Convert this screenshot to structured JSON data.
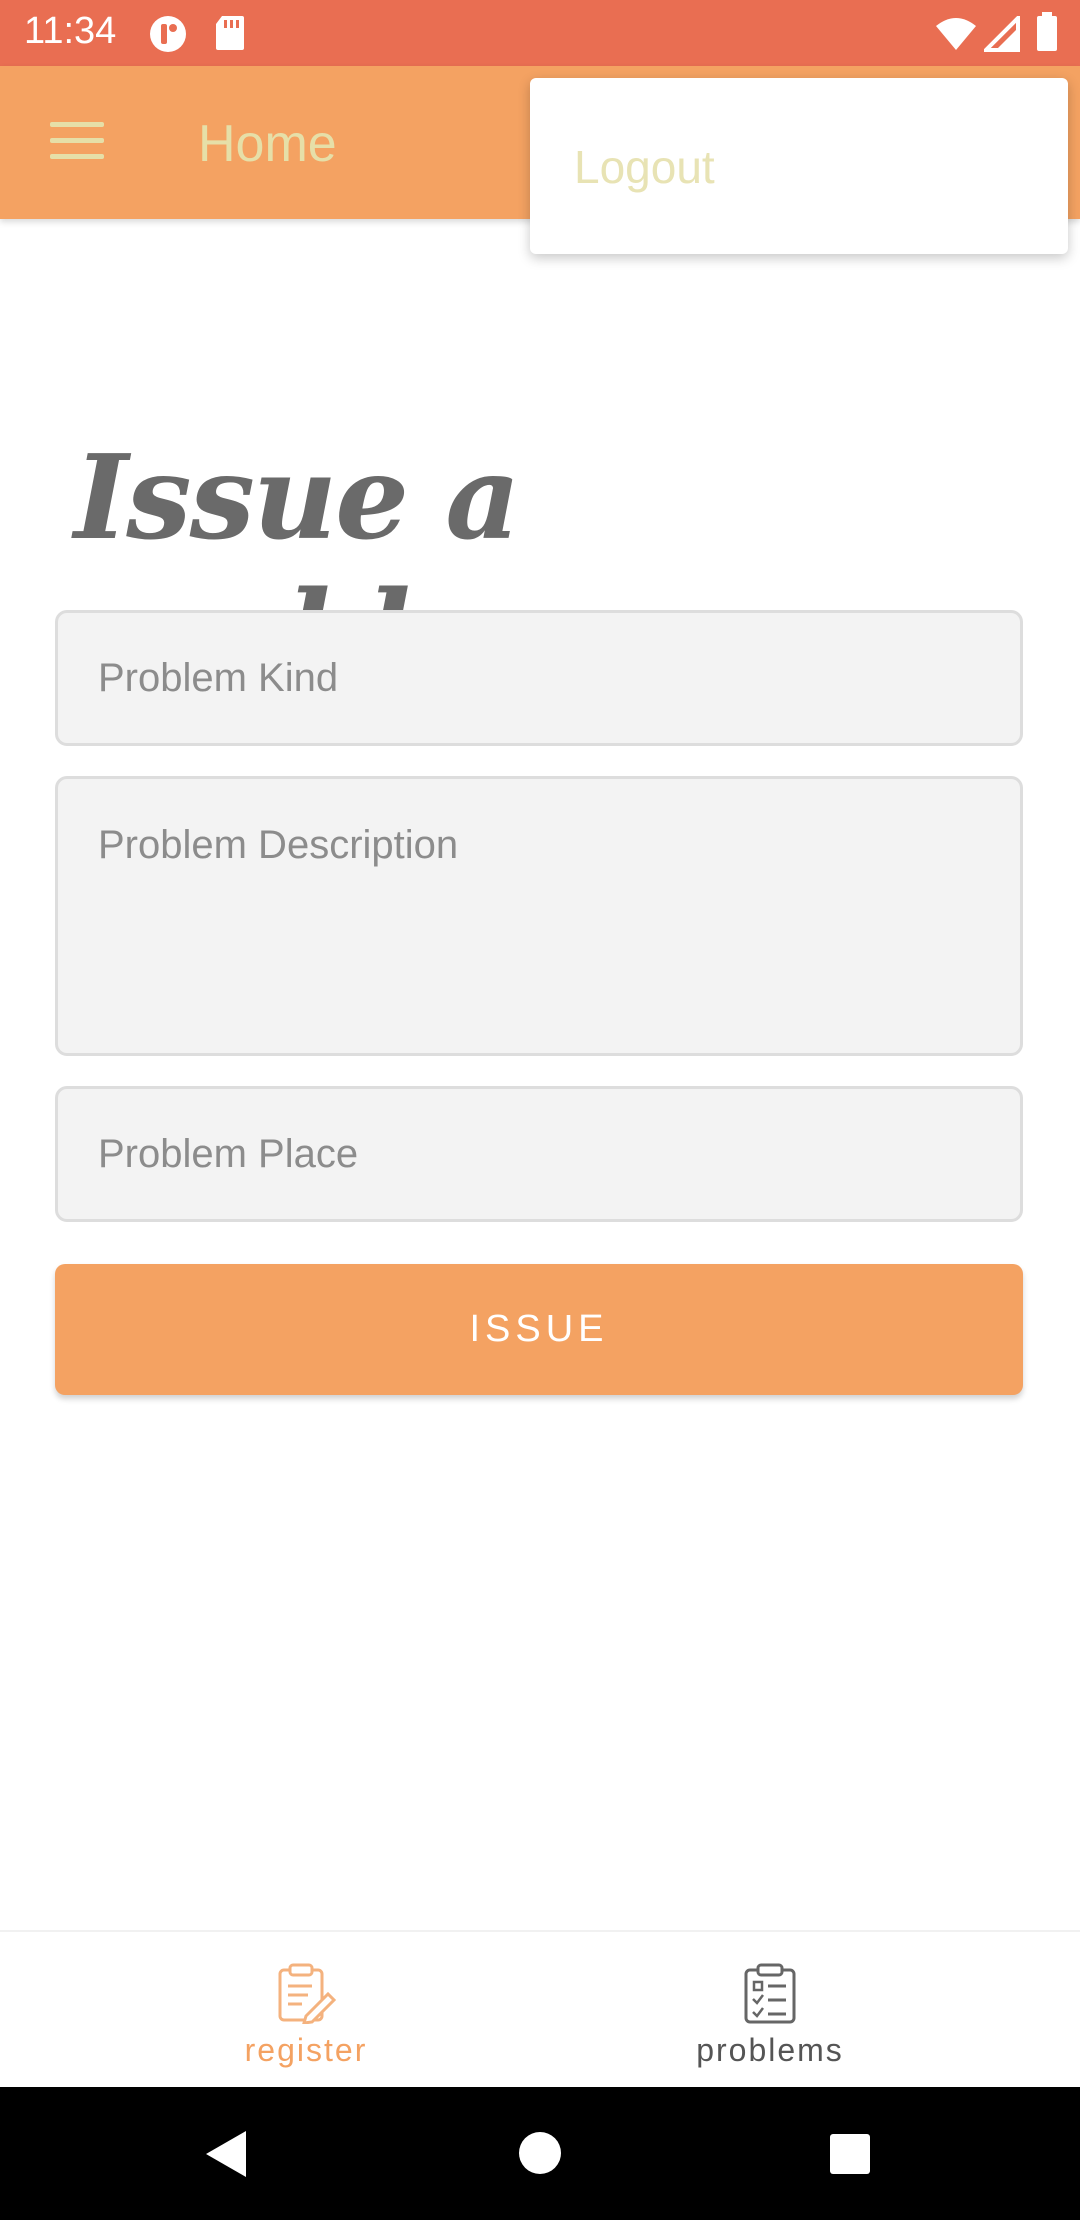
{
  "status_bar": {
    "time": "11:34",
    "icons": [
      "notification-app-icon",
      "sd-card-icon",
      "wifi-icon",
      "signal-icon",
      "battery-icon"
    ]
  },
  "app_bar": {
    "menu_icon": "hamburger-menu-icon",
    "title": "Home"
  },
  "overflow_menu": {
    "items": [
      {
        "label": "Logout"
      }
    ]
  },
  "form": {
    "heading": "Issue a problem",
    "problem_kind": {
      "placeholder": "Problem Kind",
      "value": ""
    },
    "problem_description": {
      "placeholder": "Problem Description",
      "value": ""
    },
    "problem_place": {
      "placeholder": "Problem Place",
      "value": ""
    },
    "submit_label": "ISSUE"
  },
  "bottom_nav": {
    "items": [
      {
        "label": "register",
        "icon": "clipboard-edit-icon",
        "active": true
      },
      {
        "label": "problems",
        "icon": "clipboard-list-icon",
        "active": false
      }
    ]
  },
  "system_nav": {
    "buttons": [
      "back-icon",
      "home-icon",
      "recents-icon"
    ]
  },
  "colors": {
    "status_bar": "#e96e52",
    "app_bar": "#f4a262",
    "accent": "#f4a262",
    "title_text": "#e6dfa8",
    "nav_active": "#f4a262",
    "nav_inactive": "#555555"
  }
}
